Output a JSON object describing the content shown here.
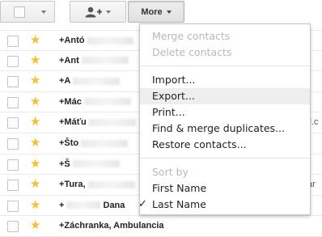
{
  "toolbar": {
    "more_label": "More"
  },
  "contacts": [
    {
      "name": "+Antó",
      "trail": ""
    },
    {
      "name": "+Ant",
      "trail": ""
    },
    {
      "name": "+A",
      "trail": ""
    },
    {
      "name": "+Mác",
      "trail": ""
    },
    {
      "name": "+Máťu",
      "trail": "il.c"
    },
    {
      "name": "+Što",
      "trail": ""
    },
    {
      "name": "+Š",
      "trail": ""
    },
    {
      "name": "+Tura,",
      "trail": "ar"
    },
    {
      "name": "+",
      "trail": ""
    },
    {
      "name": "+Záchranka, Ambulancia",
      "trail": ""
    }
  ],
  "partial_text": {
    "row9_fragment": "Dana"
  },
  "menu": {
    "merge_contacts": "Merge contacts",
    "delete_contacts": "Delete contacts",
    "import": "Import...",
    "export": "Export...",
    "print": "Print...",
    "find_merge": "Find & merge duplicates...",
    "restore": "Restore contacts...",
    "sort_by": "Sort by",
    "first_name": "First Name",
    "last_name": "Last Name",
    "checkmark": "✓"
  },
  "colors": {
    "star": "#f1c233",
    "menu_highlight": "#eeeeee",
    "disabled_text": "#b8b8b8"
  }
}
